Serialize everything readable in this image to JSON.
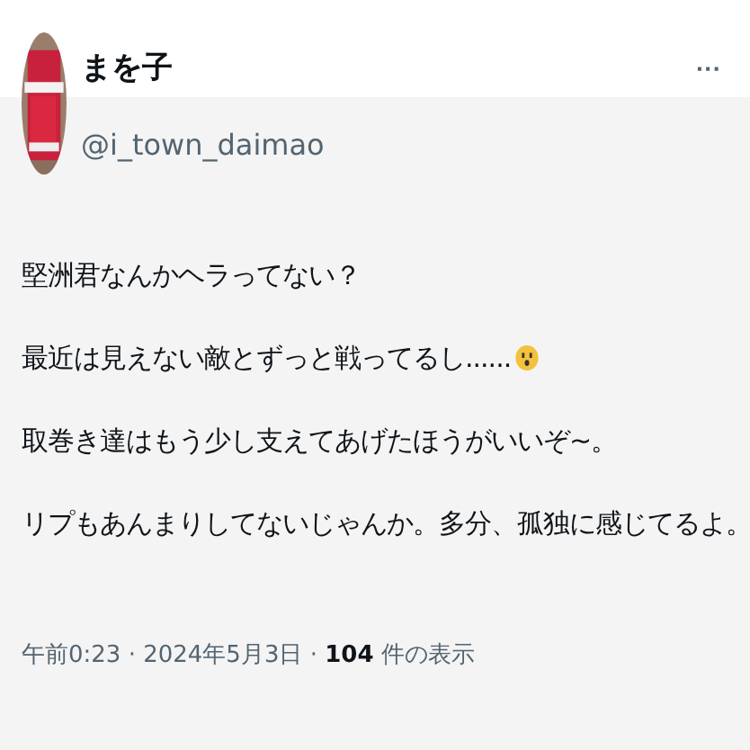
{
  "author": {
    "name": "まを子",
    "handle": "@i_town_daimao",
    "more": "···"
  },
  "lines": [
    {
      "text": "堅洲君なんかヘラってない？",
      "emoji": false
    },
    {
      "text": "最近は見えない敵とずっと戦ってるし......",
      "emoji": true
    },
    {
      "text": "取巻き達はもう少し支えてあげたほうがいいぞ~。",
      "emoji": false
    },
    {
      "text": "リプもあんまりしてないじゃんか。多分、孤独に感じてるよ。",
      "emoji": false
    }
  ],
  "meta": "午前0:23 · 2024年5月3日 · **104** 件の表示"
}
